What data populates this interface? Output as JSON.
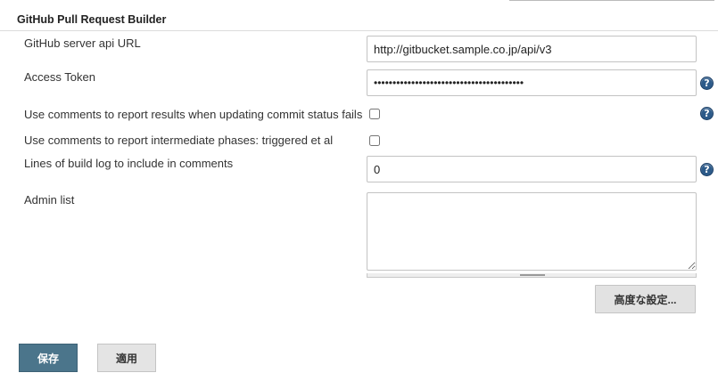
{
  "section": {
    "title": "GitHub Pull Request Builder"
  },
  "fields": {
    "server_api_url": {
      "label": "GitHub server api URL",
      "value": "http://gitbucket.sample.co.jp/api/v3"
    },
    "access_token": {
      "label": "Access Token",
      "value": "••••••••••••••••••••••••••••••••••••••••"
    },
    "comment_status_fail": {
      "label": "Use comments to report results when updating commit status fails",
      "checked": false
    },
    "comment_intermediate": {
      "label": "Use comments to report intermediate phases: triggered et al",
      "checked": false
    },
    "build_log_lines": {
      "label": "Lines of build log to include in comments",
      "value": "0"
    },
    "admin_list": {
      "label": "Admin list",
      "value": ""
    }
  },
  "help_icon_glyph": "?",
  "icons": {
    "help": "question-mark-help-icon"
  },
  "buttons": {
    "advanced": "高度な設定...",
    "save": "保存",
    "apply": "適用"
  },
  "colors": {
    "primary_button": "#4b758b",
    "help_icon": "#2d5b8a",
    "secondary_button": "#e4e4e4"
  }
}
